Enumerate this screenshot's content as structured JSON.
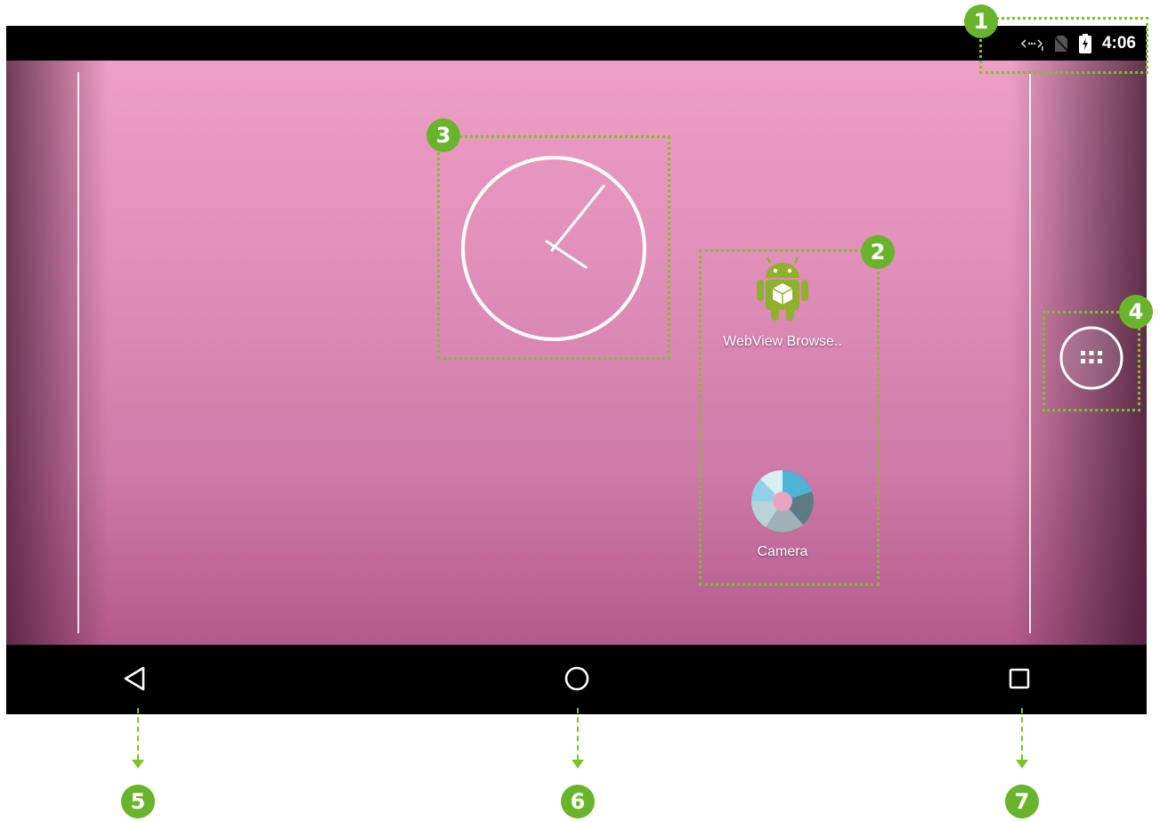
{
  "status_bar": {
    "time": "4:06",
    "icons": [
      "wifi-searching-icon",
      "no-sim-icon",
      "battery-charging-icon"
    ]
  },
  "home": {
    "widgets": [
      {
        "name": "analog-clock-widget"
      }
    ],
    "apps": [
      {
        "label": "WebView Browse..",
        "icon": "android-robot-icon"
      },
      {
        "label": "Camera",
        "icon": "camera-shutter-icon"
      }
    ],
    "all_apps_icon": "apps-grid-icon"
  },
  "nav_bar": {
    "buttons": [
      "back-icon",
      "home-icon",
      "recents-icon"
    ]
  },
  "annotations": {
    "labels": [
      "1",
      "2",
      "3",
      "4",
      "5",
      "6",
      "7"
    ],
    "color": "#7fbf2a",
    "badge_color": "#6ab42d"
  },
  "colors": {
    "wallpaper_top": "#ee9fc4",
    "wallpaper_bottom": "#b35a8c",
    "bars": "#000000"
  }
}
